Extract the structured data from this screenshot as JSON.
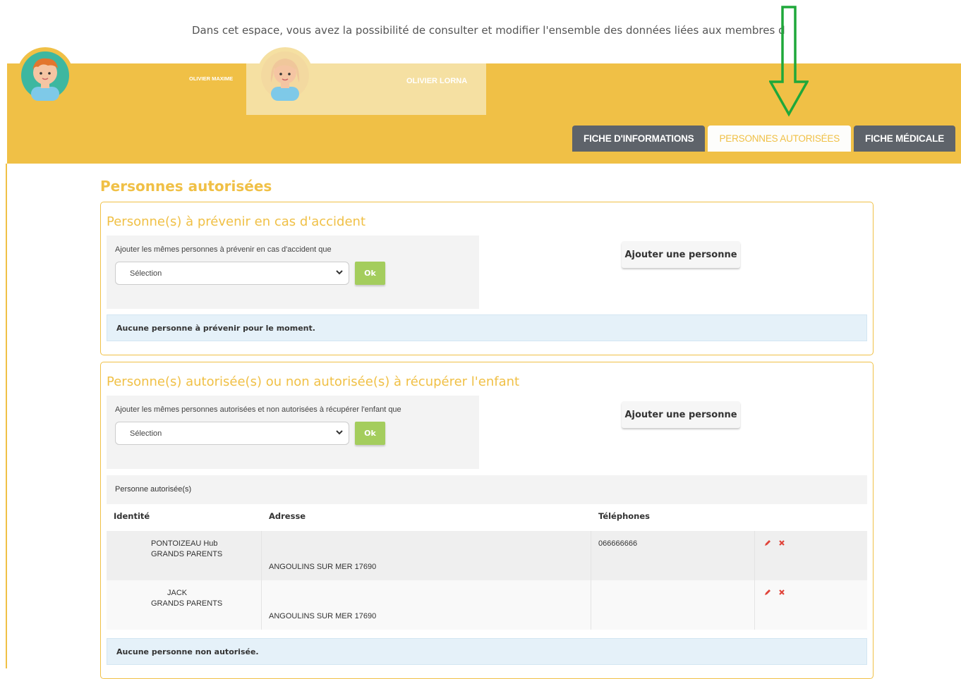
{
  "intro_text": "Dans cet espace, vous avez la possibilité de consulter et modifier l'ensemble des données liées aux membres de votre famille.",
  "children": [
    {
      "name": "OLIVIER MAXIME",
      "active": true
    },
    {
      "name": "OLIVIER LORNA",
      "active": false
    }
  ],
  "main_tabs": [
    {
      "label": "FICHE D'INFORMATIONS",
      "active": false
    },
    {
      "label": "PERSONNES AUTORISÉES",
      "active": true
    },
    {
      "label": "FICHE MÉDICALE",
      "active": false
    }
  ],
  "page_title": "Personnes autorisées",
  "accident_section": {
    "title": "Personne(s) à prévenir en cas d'accident",
    "copy_label": "Ajouter les mêmes personnes à prévenir en cas d'accident que",
    "select_value": "Sélection",
    "ok_label": "Ok",
    "add_label": "Ajouter une personne",
    "empty_message": "Aucune personne à prévenir pour le moment."
  },
  "pickup_section": {
    "title": "Personne(s) autorisée(s) ou non autorisée(s) à récupérer l'enfant",
    "copy_label": "Ajouter les mêmes personnes autorisées et non autorisées à récupérer l'enfant que",
    "select_value": "Sélection",
    "ok_label": "Ok",
    "add_label": "Ajouter une personne",
    "table_caption": "Personne autorisée(s)",
    "columns": [
      "Identité",
      "Adresse",
      "Téléphones"
    ],
    "rows": [
      {
        "name": "PONTOIZEAU Hub",
        "relation": "GRANDS PARENTS",
        "address": "ANGOULINS SUR MER 17690",
        "phone": "066666666"
      },
      {
        "name": "JACK",
        "relation": "GRANDS PARENTS",
        "address": "ANGOULINS SUR MER 17690",
        "phone": ""
      }
    ],
    "empty_message": "Aucune personne non autorisée."
  },
  "colors": {
    "accent": "#f0c046",
    "dark_tab": "#5e636a",
    "ok_green": "#a4cd5d",
    "arrow_green": "#1fa83a",
    "delete_red": "#e0443a"
  }
}
